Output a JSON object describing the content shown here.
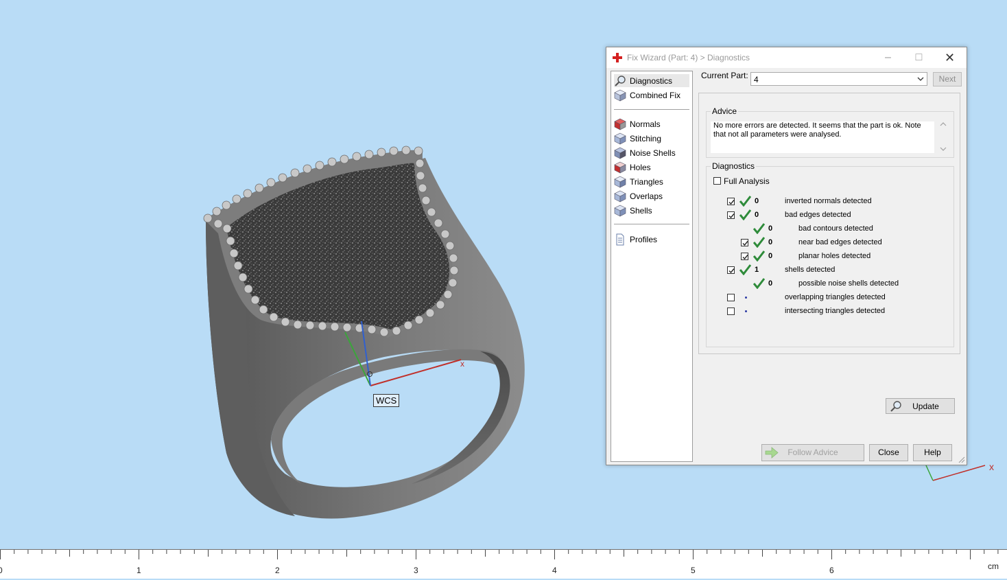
{
  "viewport": {
    "wcs_label": "WCS",
    "x_axis_label": "x",
    "corner_axis_label": "x"
  },
  "ruler": {
    "ticks": [
      "0",
      "1",
      "2",
      "3",
      "4",
      "5",
      "6"
    ],
    "unit": "cm"
  },
  "dialog": {
    "title": "Fix Wizard (Part: 4) > Diagnostics",
    "app_icon": "red-cross-icon",
    "window_buttons": {
      "minimize": "–",
      "maximize": "□",
      "close": "✕"
    },
    "nav": {
      "top_items": [
        {
          "label": "Diagnostics",
          "icon": "magnifier-icon",
          "selected": true
        },
        {
          "label": "Combined Fix",
          "icon": "cube-icon"
        }
      ],
      "fix_items": [
        {
          "label": "Normals",
          "icon": "normals-cube-icon"
        },
        {
          "label": "Stitching",
          "icon": "stitching-cube-icon"
        },
        {
          "label": "Noise Shells",
          "icon": "noise-shells-cube-icon"
        },
        {
          "label": "Holes",
          "icon": "holes-cube-icon"
        },
        {
          "label": "Triangles",
          "icon": "triangles-cube-icon"
        },
        {
          "label": "Overlaps",
          "icon": "overlaps-cube-icon"
        },
        {
          "label": "Shells",
          "icon": "shells-cube-icon"
        }
      ],
      "bottom_items": [
        {
          "label": "Profiles",
          "icon": "document-icon"
        }
      ]
    },
    "current_part_label": "Current Part:",
    "current_part_value": "4",
    "next_label": "Next",
    "advice": {
      "title": "Advice",
      "text": "No more errors are detected. It seems that the part is ok. Note that not all parameters were analysed."
    },
    "diagnostics": {
      "title": "Diagnostics",
      "full_analysis_label": "Full Analysis",
      "full_analysis_checked": false,
      "rows": [
        {
          "checkbox": true,
          "checked": true,
          "status": "ok",
          "value": "0",
          "label": "inverted normals detected",
          "indent": 0
        },
        {
          "checkbox": true,
          "checked": true,
          "status": "ok",
          "value": "0",
          "label": "bad edges detected",
          "indent": 0
        },
        {
          "checkbox": false,
          "checked": false,
          "status": "ok",
          "value": "0",
          "label": "bad contours detected",
          "indent": 1
        },
        {
          "checkbox": true,
          "checked": true,
          "status": "ok",
          "value": "0",
          "label": "near bad edges detected",
          "indent": 1
        },
        {
          "checkbox": true,
          "checked": true,
          "status": "ok",
          "value": "0",
          "label": "planar holes detected",
          "indent": 1
        },
        {
          "checkbox": true,
          "checked": true,
          "status": "ok",
          "value": "1",
          "label": "shells detected",
          "indent": 0
        },
        {
          "checkbox": false,
          "checked": false,
          "status": "ok",
          "value": "0",
          "label": "possible noise shells detected",
          "indent": 1
        },
        {
          "checkbox": true,
          "checked": false,
          "status": "unknown",
          "value": "",
          "label": "overlapping triangles detected",
          "indent": 0
        },
        {
          "checkbox": true,
          "checked": false,
          "status": "unknown",
          "value": "",
          "label": "intersecting triangles detected",
          "indent": 0
        }
      ]
    },
    "update_label": "Update",
    "follow_advice_label": "Follow Advice",
    "close_label": "Close",
    "help_label": "Help"
  },
  "colors": {
    "viewport_bg": "#b9dcf6",
    "check_green": "#2e8b3a",
    "dot_blue": "#2c3aa3"
  }
}
